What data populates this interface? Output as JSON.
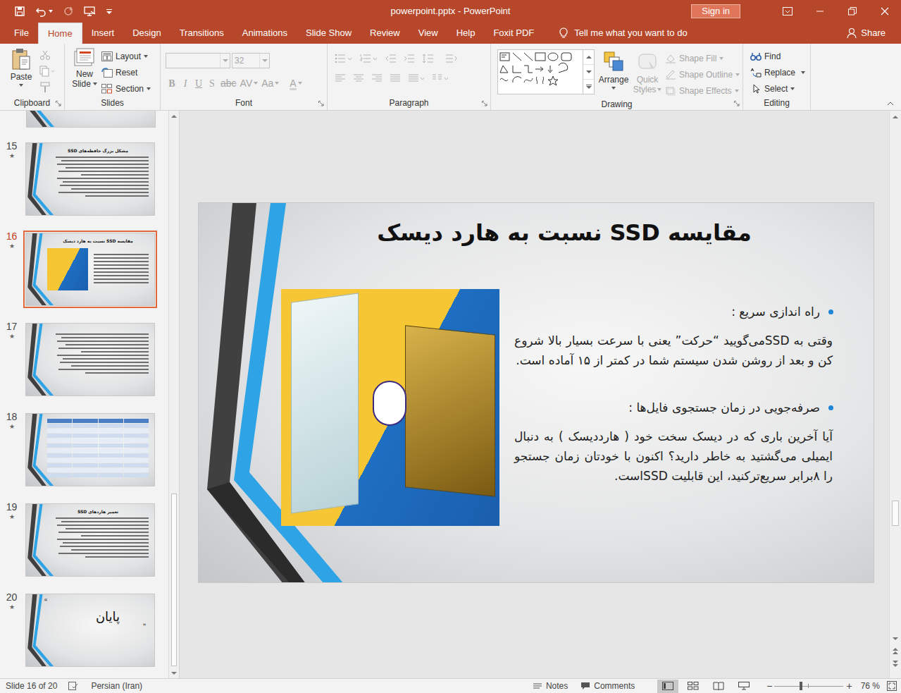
{
  "window": {
    "title": "powerpoint.pptx - PowerPoint",
    "sign_in": "Sign in"
  },
  "tabs": [
    {
      "label": "File",
      "selected": false
    },
    {
      "label": "Home",
      "selected": true
    },
    {
      "label": "Insert",
      "selected": false
    },
    {
      "label": "Design",
      "selected": false
    },
    {
      "label": "Transitions",
      "selected": false
    },
    {
      "label": "Animations",
      "selected": false
    },
    {
      "label": "Slide Show",
      "selected": false
    },
    {
      "label": "Review",
      "selected": false
    },
    {
      "label": "View",
      "selected": false
    },
    {
      "label": "Help",
      "selected": false
    },
    {
      "label": "Foxit PDF",
      "selected": false
    }
  ],
  "tell_me": "Tell me what you want to do",
  "share": "Share",
  "ribbon": {
    "clipboard": {
      "label": "Clipboard",
      "paste": "Paste"
    },
    "slides": {
      "label": "Slides",
      "new": "New",
      "slide": "Slide",
      "layout": "Layout",
      "reset": "Reset",
      "section": "Section"
    },
    "font": {
      "label": "Font",
      "size": "32",
      "disabled": true,
      "buttons": [
        "B",
        "I",
        "U",
        "S",
        "abc",
        "AV",
        "Aa",
        "A"
      ]
    },
    "paragraph": {
      "label": "Paragraph",
      "disabled": true
    },
    "drawing": {
      "label": "Drawing",
      "arrange": "Arrange",
      "quick": "Quick",
      "styles": "Styles",
      "quick_styles_disabled": true,
      "shape_commands": [
        {
          "label": "Shape Fill",
          "disabled": true
        },
        {
          "label": "Shape Outline",
          "disabled": true
        },
        {
          "label": "Shape Effects",
          "disabled": true
        }
      ]
    },
    "editing": {
      "label": "Editing",
      "find": "Find",
      "replace": "Replace",
      "select": "Select"
    }
  },
  "slides_panel": {
    "partial": {
      "kind": "text"
    },
    "thumbnails": [
      {
        "number": "15",
        "mark": "★",
        "title": "مشکل بزرگ حافظه‌های SSD",
        "kind": "text",
        "selected": false
      },
      {
        "number": "16",
        "mark": "★",
        "title": "مقایسه SSD نسبت به هارد دیسک",
        "kind": "image-text",
        "selected": true
      },
      {
        "number": "17",
        "mark": "★",
        "kind": "text",
        "selected": false
      },
      {
        "number": "18",
        "mark": "★",
        "kind": "table",
        "selected": false
      },
      {
        "number": "19",
        "mark": "★",
        "title": "تعمیر هاردهای SSD",
        "kind": "text",
        "selected": false
      },
      {
        "number": "20",
        "mark": "★",
        "title": "پایان",
        "kind": "end",
        "selected": false,
        "open_quote": "“",
        "close_quote": "„"
      }
    ]
  },
  "slide": {
    "title": "مقایسه SSD نسبت به هارد دیسک",
    "bullets": [
      {
        "heading": "راه اندازی سریع :",
        "body": "وقتی به SSDمی‌گویید “حرکت” یعنی با سرعت بسیار بالا شروع کن و بعد از روشن شدن سیستم شما در کمتر از ۱۵ آماده است."
      },
      {
        "heading": "صرفه‌جویی در زمان جستجوی فایل‌ها :",
        "body": "آیا آخرین باری که در دیسک سخت خود ( هارددیسک ) به دنبال ایمیلی می‌گشتید به خاطر دارید؟ اکنون با خودتان زمان جستجو را ۸برابر سریع‌ترکنید، این قابلیت SSDاست."
      }
    ]
  },
  "status_bar": {
    "slide_info": "Slide 16 of 20",
    "language": "Persian (Iran)",
    "notes": "Notes",
    "comments": "Comments",
    "views": [
      {
        "kind": "normal",
        "selected": true
      },
      {
        "kind": "sorter",
        "selected": false
      },
      {
        "kind": "reading",
        "selected": false
      },
      {
        "kind": "slideshow",
        "selected": false
      }
    ],
    "zoom_out": "−",
    "zoom_in": "+",
    "zoom": {
      "level": 0.38,
      "reading": "76 %"
    }
  }
}
